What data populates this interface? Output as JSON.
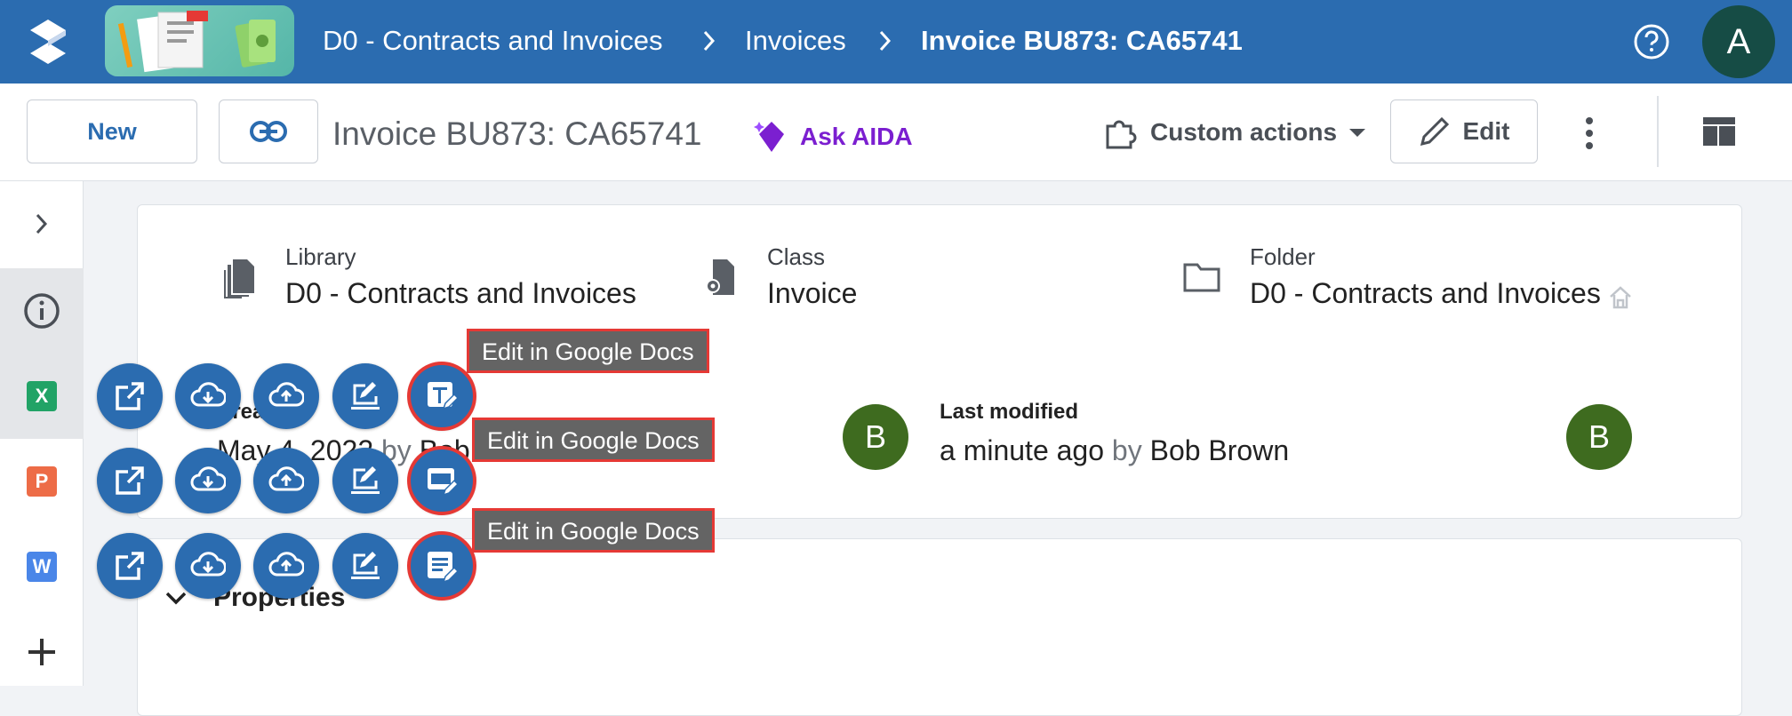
{
  "header": {
    "breadcrumbs": [
      "D0 - Contracts and Invoices",
      "Invoices",
      "Invoice BU873: CA65741"
    ],
    "user_initial": "A"
  },
  "toolbar": {
    "new_label": "New",
    "title": "Invoice BU873: CA65741",
    "ask_aida_label": "Ask AIDA",
    "custom_actions_label": "Custom actions",
    "edit_label": "Edit"
  },
  "sidebar": {
    "items": [
      {
        "icon": "chevron-right-icon"
      },
      {
        "icon": "info-icon",
        "selected": true
      },
      {
        "icon": "excel-icon",
        "letter": "X",
        "color": "#21a366",
        "selected": true
      },
      {
        "icon": "powerpoint-icon",
        "letter": "P",
        "color": "#ed6c47"
      },
      {
        "icon": "word-icon",
        "letter": "W",
        "color": "#4a86e8"
      },
      {
        "icon": "plus-icon"
      }
    ]
  },
  "details": {
    "library_label": "Library",
    "library_value": "D0 - Contracts and Invoices",
    "class_label": "Class",
    "class_value": "Invoice",
    "folder_label": "Folder",
    "folder_value": "D0 - Contracts and Invoices",
    "created_label": "Crea",
    "created_value": "May 4, 2022",
    "created_by_word": "by",
    "created_by": "Bob",
    "created_avatar": "B",
    "modified_label": "Last modified",
    "modified_value": "a minute ago",
    "modified_by_word": "by",
    "modified_by": "Bob Brown",
    "modified_avatar": "B"
  },
  "properties": {
    "label": "Properties"
  },
  "fab_rows": [
    {
      "tooltip": "Edit in Google Docs",
      "edit_icon": "sheets-edit-icon"
    },
    {
      "tooltip": "Edit in Google Docs",
      "edit_icon": "slides-edit-icon"
    },
    {
      "tooltip": "Edit in Google Docs",
      "edit_icon": "docs-edit-icon"
    }
  ],
  "colors": {
    "brand": "#2b6cb0",
    "aida": "#7b1fd0",
    "highlight": "#e53935"
  }
}
